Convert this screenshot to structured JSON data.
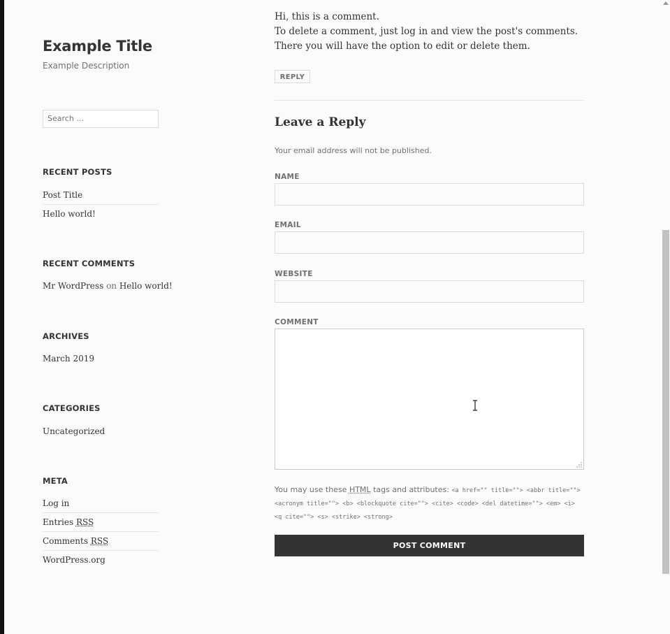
{
  "site": {
    "title": "Example Title",
    "description": "Example Description"
  },
  "search": {
    "placeholder": "Search …"
  },
  "widgets": {
    "recent_posts": {
      "title": "RECENT POSTS",
      "items": [
        "Post Title",
        "Hello world!"
      ]
    },
    "recent_comments": {
      "title": "RECENT COMMENTS",
      "author": "Mr WordPress",
      "on": "on",
      "post": "Hello world!"
    },
    "archives": {
      "title": "ARCHIVES",
      "items": [
        "March 2019"
      ]
    },
    "categories": {
      "title": "CATEGORIES",
      "items": [
        "Uncategorized"
      ]
    },
    "meta": {
      "title": "META",
      "login": "Log in",
      "entries": "Entries",
      "comments": "Comments",
      "rss": "RSS",
      "wordpress_org": "WordPress.org"
    }
  },
  "comment": {
    "line1": "Hi, this is a comment.",
    "line2": "To delete a comment, just log in and view the post's comments. There you will have the option to edit or delete them.",
    "reply_label": "REPLY"
  },
  "reply_form": {
    "title": "Leave a Reply",
    "notes": "Your email address will not be published.",
    "name_label": "NAME",
    "email_label": "EMAIL",
    "website_label": "WEBSITE",
    "comment_label": "COMMENT",
    "allowed_prefix": "You may use these",
    "allowed_abbr": "HTML",
    "allowed_suffix": "tags and attributes:",
    "allowed_tags": "<a href=\"\" title=\"\"> <abbr title=\"\"> <acronym title=\"\"> <b> <blockquote cite=\"\"> <cite> <code> <del datetime=\"\"> <em> <i> <q cite=\"\"> <s> <strike> <strong>",
    "submit_label": "POST COMMENT"
  },
  "colors": {
    "background": "#fbfbfb",
    "text": "#333333",
    "muted": "#707070",
    "border": "#dcdcdc",
    "button": "#333333"
  },
  "icons": [
    "text-cursor-icon",
    "resize-grip-icon",
    "scroll-up-arrow-icon"
  ]
}
